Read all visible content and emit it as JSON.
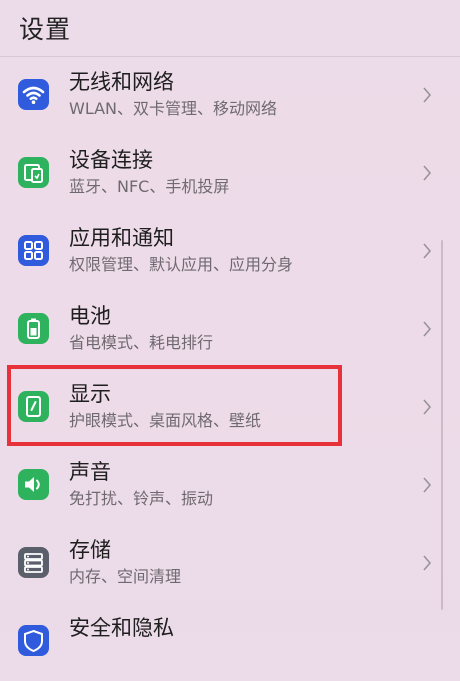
{
  "header": {
    "title": "设置"
  },
  "items": [
    {
      "title": "无线和网络",
      "subtitle": "WLAN、双卡管理、移动网络",
      "icon": "wifi-icon",
      "color": "#2f5bdc"
    },
    {
      "title": "设备连接",
      "subtitle": "蓝牙、NFC、手机投屏",
      "icon": "device-connect-icon",
      "color": "#2fb25e"
    },
    {
      "title": "应用和通知",
      "subtitle": "权限管理、默认应用、应用分身",
      "icon": "apps-grid-icon",
      "color": "#2f5bdc"
    },
    {
      "title": "电池",
      "subtitle": "省电模式、耗电排行",
      "icon": "battery-icon",
      "color": "#2fb25e"
    },
    {
      "title": "显示",
      "subtitle": "护眼模式、桌面风格、壁纸",
      "icon": "display-icon",
      "color": "#2fb25e"
    },
    {
      "title": "声音",
      "subtitle": "免打扰、铃声、振动",
      "icon": "speaker-icon",
      "color": "#2fb25e"
    },
    {
      "title": "存储",
      "subtitle": "内存、空间清理",
      "icon": "storage-icon",
      "color": "#5a5f6b"
    },
    {
      "title": "安全和隐私",
      "subtitle": "",
      "icon": "shield-icon",
      "color": "#2f5bdc"
    }
  ],
  "highlight_color": "#e8323a"
}
